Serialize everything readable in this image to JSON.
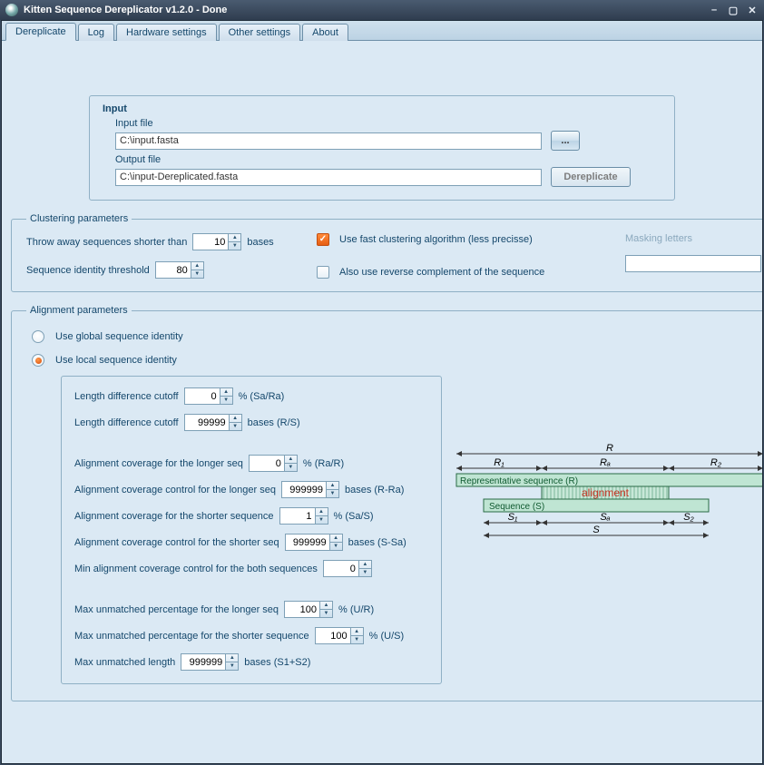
{
  "window": {
    "title": "Kitten Sequence Dereplicator  v1.2.0 - Done"
  },
  "tabs": {
    "dereplicate": "Dereplicate",
    "log": "Log",
    "hw": "Hardware settings",
    "other": "Other settings",
    "about": "About"
  },
  "input": {
    "section_title": "Input",
    "input_label": "Input file",
    "input_value": "C:\\input.fasta",
    "output_label": "Output file",
    "output_value": "C:\\input-Dereplicated.fasta",
    "browse_label": "...",
    "dereplicate_label": "Dereplicate"
  },
  "clustering": {
    "legend": "Clustering parameters",
    "throw_label_pre": "Throw away sequences shorter than",
    "throw_value": "10",
    "throw_label_post": "bases",
    "identity_label": "Sequence identity threshold",
    "identity_value": "80",
    "fast_label": "Use fast clustering algorithm (less precisse)",
    "revcomp_label": "Also use reverse complement of the sequence",
    "masking_label": "Masking letters",
    "masking_value": ""
  },
  "alignment": {
    "legend": "Alignment parameters",
    "radio_global": "Use global sequence identity",
    "radio_local": "Use local sequence identity",
    "ld_cutoff_pct_label": "Length difference cutoff",
    "ld_cutoff_pct_value": "0",
    "ld_cutoff_pct_post": "% (Sa/Ra)",
    "ld_cutoff_bases_label": "Length difference cutoff",
    "ld_cutoff_bases_value": "99999",
    "ld_cutoff_bases_post": "bases (R/S)",
    "cov_longer_label": "Alignment coverage for the longer seq",
    "cov_longer_value": "0",
    "cov_longer_post": "% (Ra/R)",
    "cov_longer_ctrl_label": "Alignment coverage control for the longer seq",
    "cov_longer_ctrl_value": "999999",
    "cov_longer_ctrl_post": "bases (R-Ra)",
    "cov_shorter_label": "Alignment coverage for the shorter sequence",
    "cov_shorter_value": "1",
    "cov_shorter_post": "% (Sa/S)",
    "cov_shorter_ctrl_label": "Alignment coverage control for the shorter seq",
    "cov_shorter_ctrl_value": "999999",
    "cov_shorter_ctrl_post": "bases (S-Sa)",
    "min_cov_label": "Min alignment coverage control for the both sequences",
    "min_cov_value": "0",
    "unmatched_longer_label": "Max unmatched percentage for the longer seq",
    "unmatched_longer_value": "100",
    "unmatched_longer_post": "% (U/R)",
    "unmatched_shorter_label": "Max unmatched percentage for the shorter sequence",
    "unmatched_shorter_value": "100",
    "unmatched_shorter_post": "% (U/S)",
    "unmatched_len_label": "Max unmatched length",
    "unmatched_len_value": "999999",
    "unmatched_len_post": "bases (S1+S2)"
  },
  "diagram": {
    "R": "R",
    "R1": "R₁",
    "Ra": "Rₐ",
    "R2": "R₂",
    "rep_label": "Representative sequence (R)",
    "alignment": "alignment",
    "seq_label": "Sequence (S)",
    "S1": "S₁",
    "Sa": "Sₐ",
    "S2": "S₂",
    "S": "S"
  }
}
